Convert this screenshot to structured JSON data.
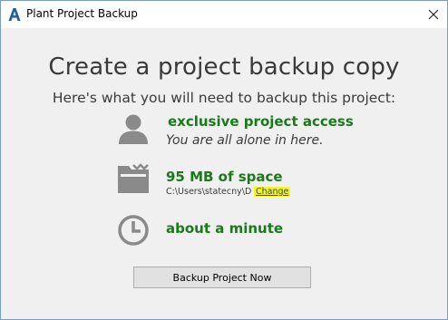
{
  "window": {
    "title": "Plant Project Backup",
    "close_glyph": "✕"
  },
  "main": {
    "heading": "Create a project backup copy",
    "subheading": "Here's what you will need to backup this project:",
    "requirements": [
      {
        "icon": "user-silhouette-icon",
        "title": "exclusive project access",
        "subtitle": "You are all alone in here."
      },
      {
        "icon": "folder-icon",
        "title": "95 MB of space",
        "path": "C:\\Users\\statecny\\D",
        "change_label": "Change"
      },
      {
        "icon": "clock-icon",
        "title": "about a minute"
      }
    ],
    "backup_button_label": "Backup Project Now"
  },
  "colors": {
    "accent_green": "#1a7a1a",
    "link_highlight": "#f5f52a",
    "icon_gray": "#8a8a8a"
  }
}
